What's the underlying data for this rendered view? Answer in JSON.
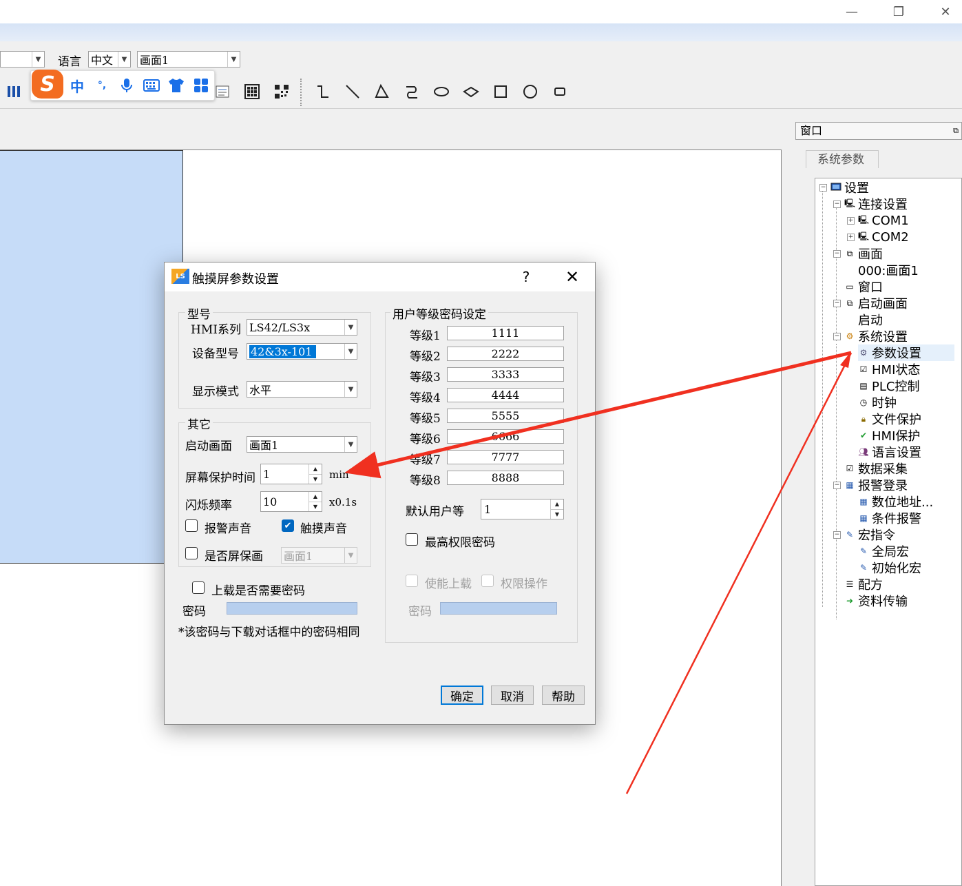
{
  "window": {
    "minimize_glyph": "—",
    "restore_glyph": "❐",
    "close_glyph": "✕"
  },
  "toolbar1": {
    "language_label": "语言",
    "language_value": "中文",
    "screen_value": "画面1"
  },
  "ime": {
    "logo": "S",
    "mode": "中",
    "punct": "°,"
  },
  "panel": {
    "title": "窗口",
    "tab": "系统参数"
  },
  "tree": {
    "items": [
      {
        "label": "设置"
      },
      {
        "label": "连接设置"
      },
      {
        "label": "COM1"
      },
      {
        "label": "COM2"
      },
      {
        "label": "画面"
      },
      {
        "label": "000:画面1"
      },
      {
        "label": "窗口"
      },
      {
        "label": "启动画面"
      },
      {
        "label": "启动"
      },
      {
        "label": "系统设置"
      },
      {
        "label": "参数设置"
      },
      {
        "label": "HMI状态"
      },
      {
        "label": "PLC控制"
      },
      {
        "label": "时钟"
      },
      {
        "label": "文件保护"
      },
      {
        "label": "HMI保护"
      },
      {
        "label": "语言设置"
      },
      {
        "label": "数据采集"
      },
      {
        "label": "报警登录"
      },
      {
        "label": "数位地址..."
      },
      {
        "label": "条件报警"
      },
      {
        "label": "宏指令"
      },
      {
        "label": "全局宏"
      },
      {
        "label": "初始化宏"
      },
      {
        "label": "配方"
      },
      {
        "label": "资料传输"
      }
    ]
  },
  "dialog": {
    "icon_text": "LS",
    "title": "触摸屏参数设置",
    "help_glyph": "?",
    "close_glyph": "✕",
    "model_group": {
      "label": "型号",
      "hmi_series_label": "HMI系列",
      "hmi_series_value": "LS42/LS3x",
      "device_model_label": "设备型号",
      "device_model_value": "42&3x-101",
      "display_mode_label": "显示模式",
      "display_mode_value": "水平"
    },
    "other_group": {
      "label": "其它",
      "startup_screen_label": "启动画面",
      "startup_screen_value": "画面1",
      "saver_time_label": "屏幕保护时间",
      "saver_time_value": "1",
      "saver_time_unit": "min",
      "blink_label": "闪烁频率",
      "blink_value": "10",
      "blink_unit": "x0.1s",
      "alarm_sound_label": "报警声音",
      "alarm_sound_checked": false,
      "touch_sound_label": "触摸声音",
      "touch_sound_checked": true,
      "screen_saver_label": "是否屏保画",
      "screen_saver_checked": false,
      "screen_saver_value": "画面1"
    },
    "upload": {
      "need_pwd_label": "上载是否需要密码",
      "pwd_label": "密码",
      "note": "*该密码与下载对话框中的密码相同"
    },
    "user_group": {
      "label": "用户等级密码设定",
      "levels": [
        {
          "label": "等级1",
          "value": "1111"
        },
        {
          "label": "等级2",
          "value": "2222"
        },
        {
          "label": "等级3",
          "value": "3333"
        },
        {
          "label": "等级4",
          "value": "4444"
        },
        {
          "label": "等级5",
          "value": "5555"
        },
        {
          "label": "等级6",
          "value": "6666"
        },
        {
          "label": "等级7",
          "value": "7777"
        },
        {
          "label": "等级8",
          "value": "8888"
        }
      ],
      "default_user_label": "默认用户等",
      "default_user_value": "1",
      "max_pwd_label": "最高权限密码",
      "enable_upload_label": "使能上载",
      "perm_op_label": "权限操作",
      "pwd_label": "密码"
    },
    "buttons": {
      "ok": "确定",
      "cancel": "取消",
      "help": "帮助"
    }
  },
  "colors": {
    "arrow": "#f03020",
    "selection": "#0078d7",
    "canvas_rect": "#c6dcf8"
  }
}
